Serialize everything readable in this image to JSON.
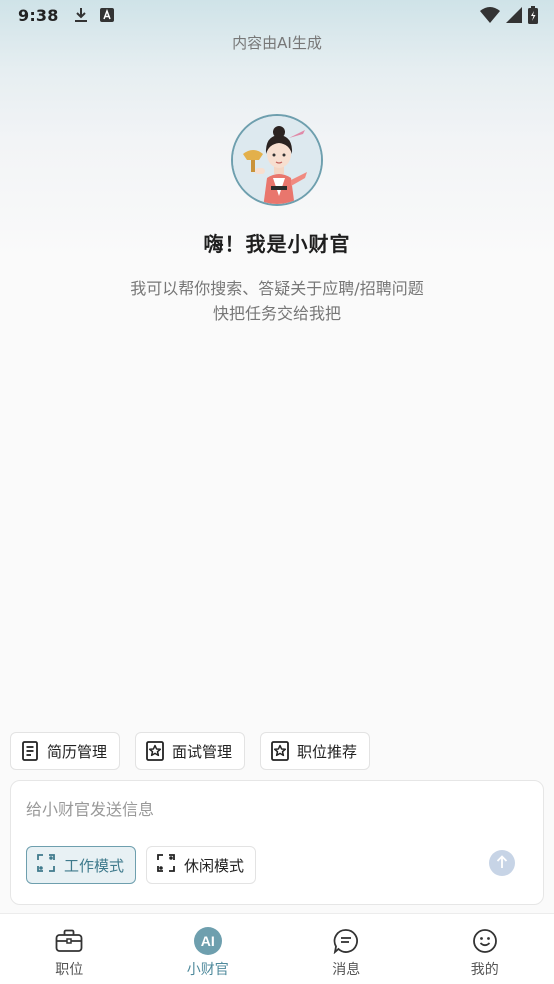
{
  "status_bar": {
    "time": "9:38",
    "left_icons": [
      "download-icon",
      "keyboard-a-icon"
    ],
    "right_icons": [
      "wifi-icon",
      "signal-icon",
      "battery-charging-icon"
    ]
  },
  "ai_notice": "内容由AI生成",
  "assistant": {
    "greeting": "嗨！我是小财官",
    "intro_line1": "我可以帮你搜索、答疑关于应聘/招聘问题",
    "intro_line2": "快把任务交给我把"
  },
  "quick_actions": [
    {
      "label": "简历管理",
      "icon": "resume-icon"
    },
    {
      "label": "面试管理",
      "icon": "star-doc-icon"
    },
    {
      "label": "职位推荐",
      "icon": "star-doc-icon"
    }
  ],
  "composer": {
    "placeholder": "给小财官发送信息",
    "modes": [
      {
        "label": "工作模式",
        "active": true
      },
      {
        "label": "休闲模式",
        "active": false
      }
    ],
    "send_icon": "arrow-up-icon"
  },
  "tabs": [
    {
      "label": "职位",
      "icon": "briefcase-icon",
      "active": false
    },
    {
      "label": "小财官",
      "icon": "ai-badge-icon",
      "badge_text": "AI",
      "active": true
    },
    {
      "label": "消息",
      "icon": "message-icon",
      "active": false
    },
    {
      "label": "我的",
      "icon": "smiley-icon",
      "active": false
    }
  ],
  "colors": {
    "accent": "#6e9fae",
    "accent_text": "#4f8a9c",
    "send_button": "#c7d4e6"
  }
}
